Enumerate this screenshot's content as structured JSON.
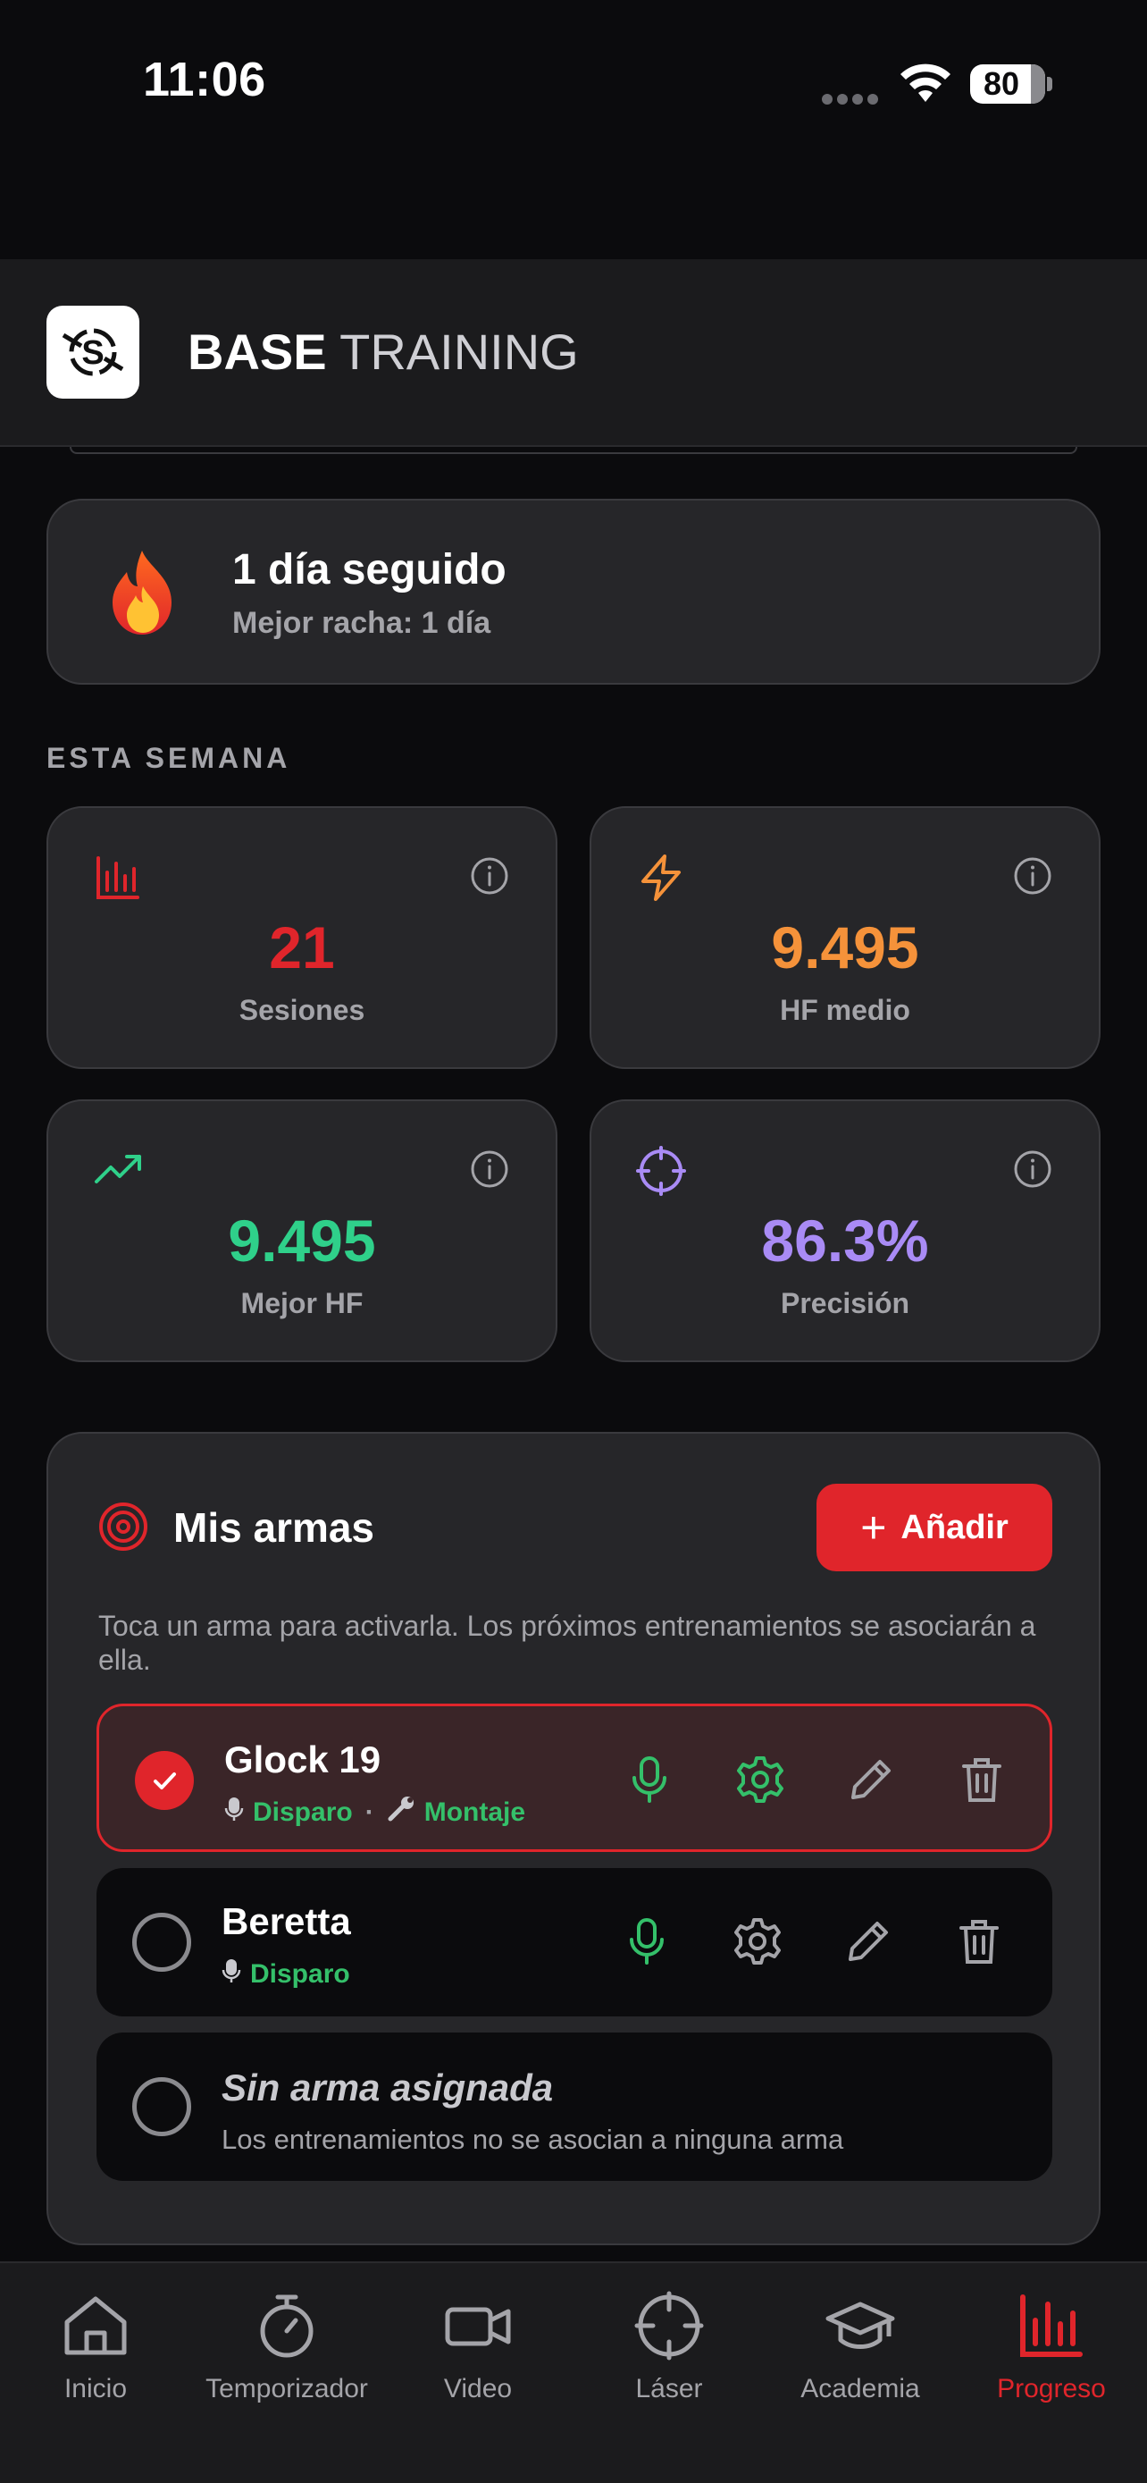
{
  "status_bar": {
    "time": "11:06",
    "battery": "80"
  },
  "header": {
    "brand_bold": "BASE",
    "brand_light": "TRAINING",
    "logo_icon": "target-s-logo-icon"
  },
  "streak": {
    "title": "1 día seguido",
    "subtitle": "Mejor racha: 1 día",
    "icon": "fire-icon"
  },
  "week": {
    "section_label": "ESTA SEMANA",
    "stats": [
      {
        "value": "21",
        "label": "Sesiones",
        "icon": "bar-chart-icon",
        "color": "#e0252b"
      },
      {
        "value": "9.495",
        "label": "HF medio",
        "icon": "lightning-icon",
        "color": "#f5923a"
      },
      {
        "value": "9.495",
        "label": "Mejor HF",
        "icon": "trending-up-icon",
        "color": "#2fd08a"
      },
      {
        "value": "86.3%",
        "label": "Precisión",
        "icon": "crosshair-icon",
        "color": "#a98bf5"
      }
    ]
  },
  "weapons": {
    "title": "Mis armas",
    "add_label": "Añadir",
    "description": "Toca un arma para activarla. Los próximos entrenamientos se asociarán a ella.",
    "items": [
      {
        "name": "Glock 19",
        "tag1": "Disparo",
        "tag2": "Montaje",
        "active": true
      },
      {
        "name": "Beretta",
        "tag1": "Disparo",
        "active": false
      }
    ],
    "none": {
      "title": "Sin arma asignada",
      "subtitle": "Los entrenamientos no se asocian a ninguna arma"
    }
  },
  "colors": {
    "accent": "#e0252b",
    "success": "#34c06a",
    "card": "#262629",
    "background": "#0b0b0d"
  },
  "nav": [
    {
      "label": "Inicio",
      "icon": "home-icon"
    },
    {
      "label": "Temporizador",
      "icon": "stopwatch-icon"
    },
    {
      "label": "Video",
      "icon": "video-camera-icon"
    },
    {
      "label": "Láser",
      "icon": "crosshair-icon"
    },
    {
      "label": "Academia",
      "icon": "graduation-cap-icon"
    },
    {
      "label": "Progreso",
      "icon": "bar-chart-icon",
      "active": true
    }
  ]
}
